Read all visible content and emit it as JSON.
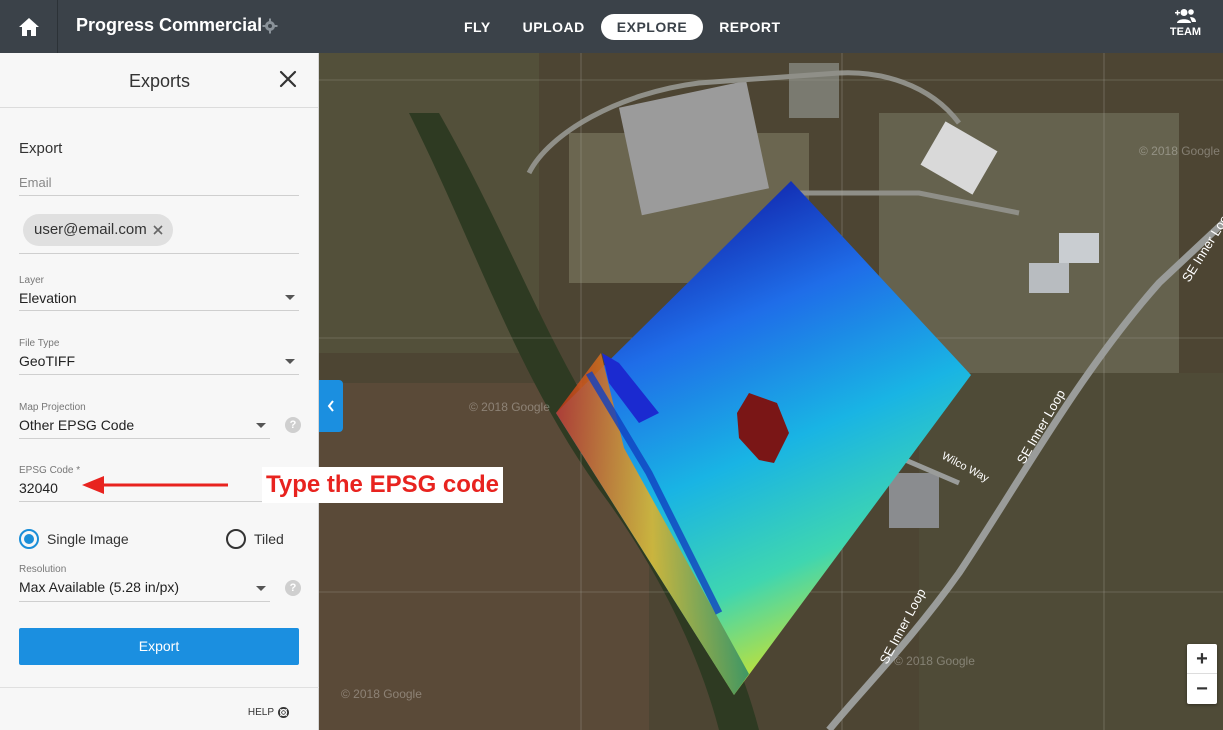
{
  "topbar": {
    "project_title": "Progress Commercial",
    "nav": [
      {
        "label": "FLY",
        "active": false
      },
      {
        "label": "UPLOAD",
        "active": false
      },
      {
        "label": "EXPLORE",
        "active": true
      },
      {
        "label": "REPORT",
        "active": false
      }
    ],
    "team_label": "TEAM"
  },
  "panel": {
    "title": "Exports",
    "section_title": "Export",
    "email": {
      "placeholder": "Email",
      "chip": "user@email.com"
    },
    "layer": {
      "label": "Layer",
      "value": "Elevation"
    },
    "file_type": {
      "label": "File Type",
      "value": "GeoTIFF"
    },
    "map_projection": {
      "label": "Map Projection",
      "value": "Other EPSG Code"
    },
    "epsg_code": {
      "label": "EPSG Code *",
      "value": "32040"
    },
    "output_mode": {
      "single_label": "Single Image",
      "tiled_label": "Tiled",
      "selected": "single"
    },
    "resolution": {
      "label": "Resolution",
      "value": "Max Available (5.28 in/px)"
    },
    "export_label": "Export",
    "help_label": "HELP"
  },
  "annotation": {
    "text": "Type the EPSG code",
    "color": "#e8231f"
  },
  "map": {
    "road_labels": [
      "SE Inner Loop",
      "SE Inner Loop",
      "SE Inner Loop",
      "Wilco Way"
    ],
    "watermarks": [
      "© 2018 Google",
      "© 2018 Google",
      "© 2018 Google",
      "© 2018 Google"
    ],
    "zoom_in": "+",
    "zoom_out": "−"
  },
  "colors": {
    "accent": "#1b8fe0",
    "topbar": "#3b4249"
  }
}
